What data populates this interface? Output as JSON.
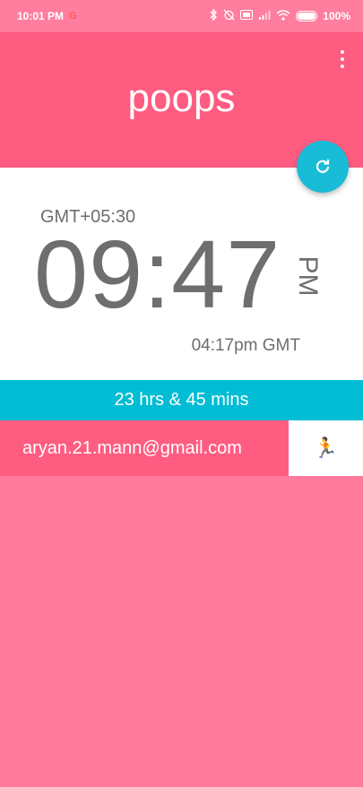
{
  "status_bar": {
    "time": "10:01 PM",
    "battery": "100%",
    "battery_level": 1.0,
    "icons": [
      "google-icon",
      "bluetooth-icon",
      "alarm-off-icon",
      "volte-icon",
      "signal-icon",
      "wifi-icon",
      "battery-icon"
    ]
  },
  "app": {
    "title": "poops"
  },
  "clock": {
    "timezone": "GMT+05:30",
    "time": "09:47",
    "ampm": "PM",
    "gmt_time": "04:17pm GMT"
  },
  "difference": {
    "text": "23 hrs & 45 mins"
  },
  "user": {
    "email": "aryan.21.mann@gmail.com",
    "action_icon": "running-person-icon",
    "action_glyph": "🏃"
  },
  "colors": {
    "app_bar": "#ff5c81",
    "status_bar": "#ff7d9e",
    "fab": "#19bcd7",
    "difference_bar": "#00bcd4",
    "background": "#ff7a9c"
  }
}
